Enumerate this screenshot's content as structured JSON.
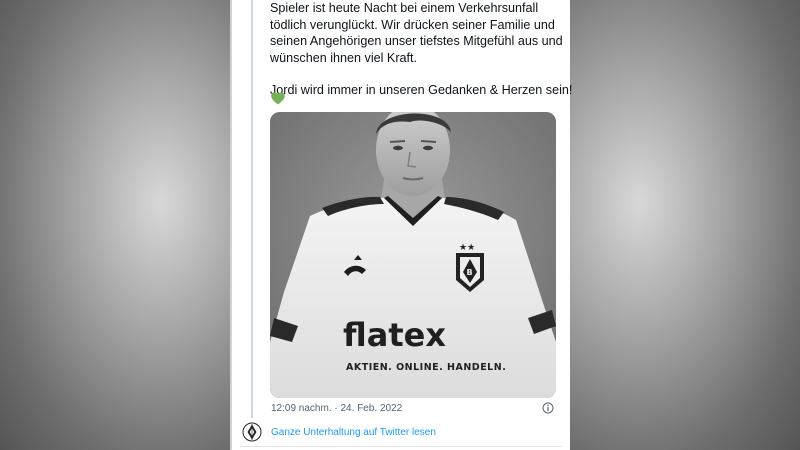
{
  "tweet": {
    "lines": [
      "Spieler ist heute Nacht bei einem Verkehrsunfall",
      "tödlich verunglückt. Wir drücken seiner Familie und",
      "seinen Angehörigen unser tiefstes Mitgefühl aus und",
      "wünschen ihnen viel Kraft."
    ],
    "closing_line": "Jordi wird immer in unseren Gedanken & Herzen sein!",
    "emoji": "green-heart-icon",
    "heart_color": "#78b159",
    "timestamp": "12:09 nachm. · 24. Feb. 2022"
  },
  "photo": {
    "shirt_sponsor": "flatex",
    "shirt_tagline": "AKTIEN. ONLINE. HANDELN."
  },
  "footer": {
    "link_text": "Ganze Unterhaltung auf Twitter lesen",
    "link_color": "#1d9bf0"
  },
  "colors": {
    "text": "#0f1419",
    "muted": "#536471",
    "thread_line": "#cfd9de"
  }
}
